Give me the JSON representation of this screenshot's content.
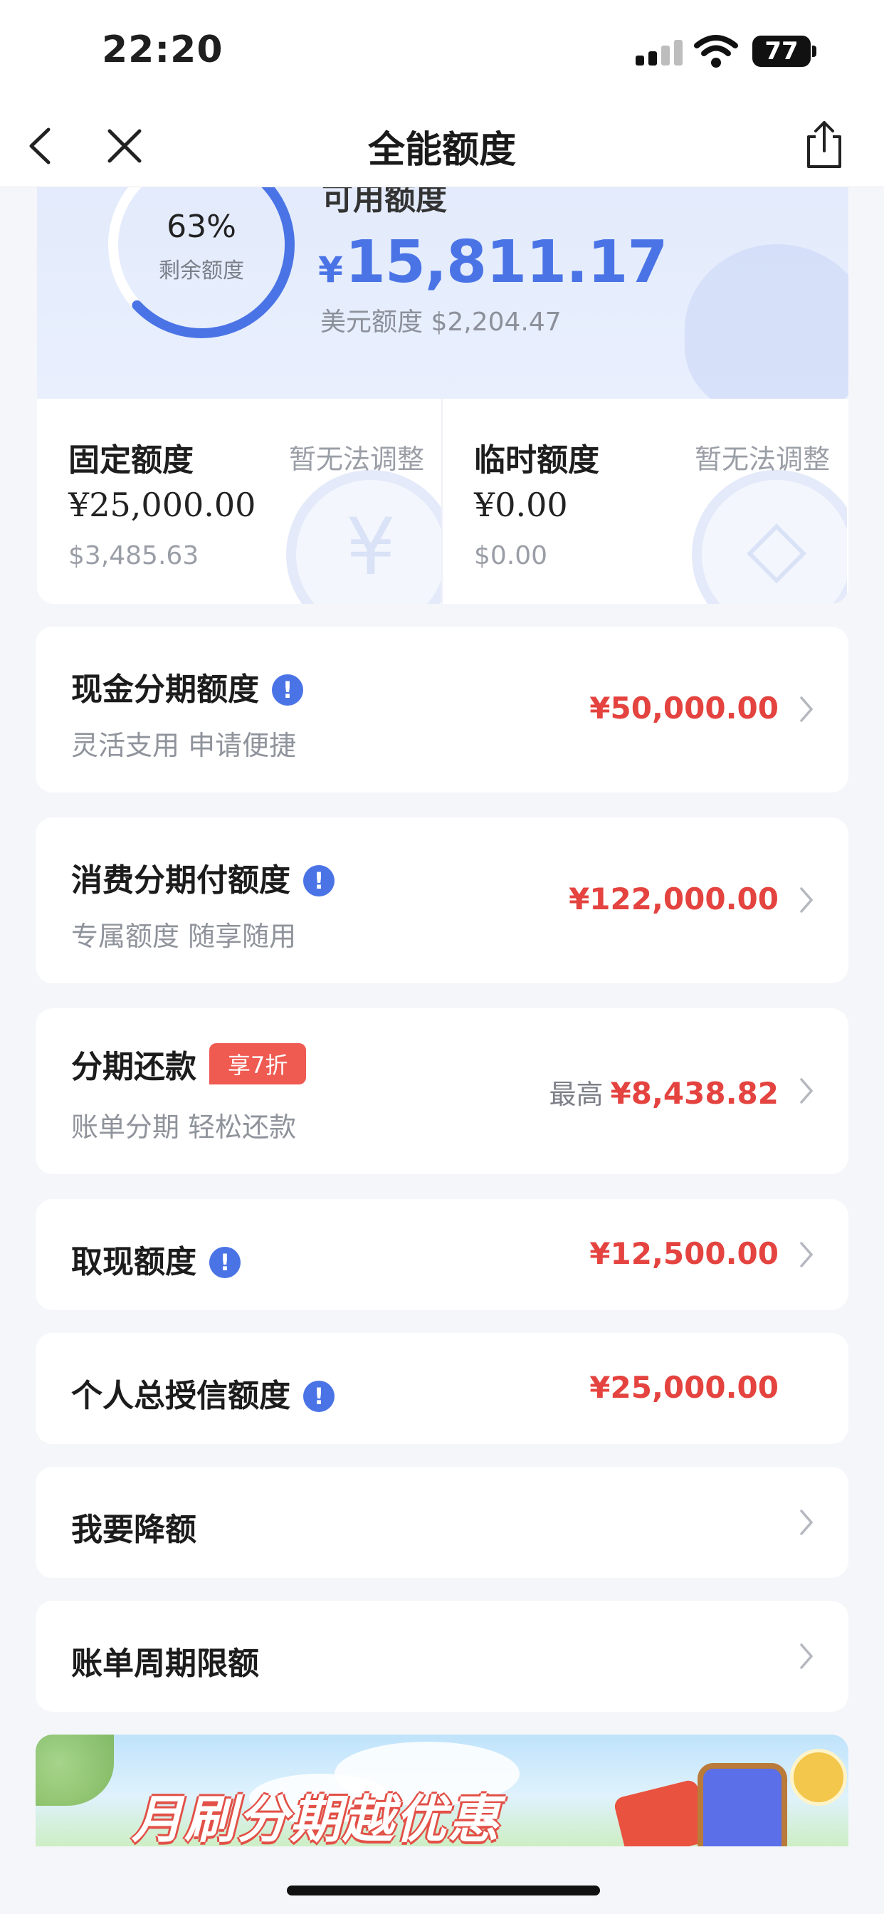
{
  "status_bar": {
    "time": "22:20",
    "battery": "77"
  },
  "nav": {
    "title": "全能额度"
  },
  "credit": {
    "ring_percent": "63%",
    "ring_label": "剩余额度",
    "ring_fraction": 0.63,
    "available_label": "可用额度",
    "available_currency": "¥",
    "available_amount": "15,811.17",
    "usd_label": "美元额度 $2,204.47",
    "fixed": {
      "title": "固定额度",
      "note": "暂无法调整",
      "amount": "¥25,000.00",
      "usd": "$3,485.63"
    },
    "temporary": {
      "title": "临时额度",
      "note": "暂无法调整",
      "amount": "¥0.00",
      "usd": "$0.00"
    }
  },
  "items": [
    {
      "title": "现金分期额度",
      "subtitle": "灵活支用 申请便捷",
      "amount": "¥50,000.00"
    },
    {
      "title": "消费分期付额度",
      "subtitle": "专属额度 随享随用",
      "amount": "¥122,000.00"
    },
    {
      "title": "分期还款",
      "badge": "享7折",
      "subtitle": "账单分期 轻松还款",
      "amount_prefix": "最高",
      "amount": "¥8,438.82"
    },
    {
      "title": "取现额度",
      "amount": "¥12,500.00"
    },
    {
      "title": "个人总授信额度",
      "amount": "¥25,000.00"
    },
    {
      "title": "我要降额"
    },
    {
      "title": "账单周期限额"
    }
  ],
  "banner": {
    "text": "月刷分期越优惠"
  },
  "colors": {
    "accent": "#4a74e6",
    "amount_red": "#e4433f",
    "background": "#f5f6fa"
  },
  "icons": [
    "back-icon",
    "close-icon",
    "share-icon",
    "info-icon",
    "chevron-right-icon",
    "signal-icon",
    "wifi-icon",
    "battery-icon"
  ]
}
